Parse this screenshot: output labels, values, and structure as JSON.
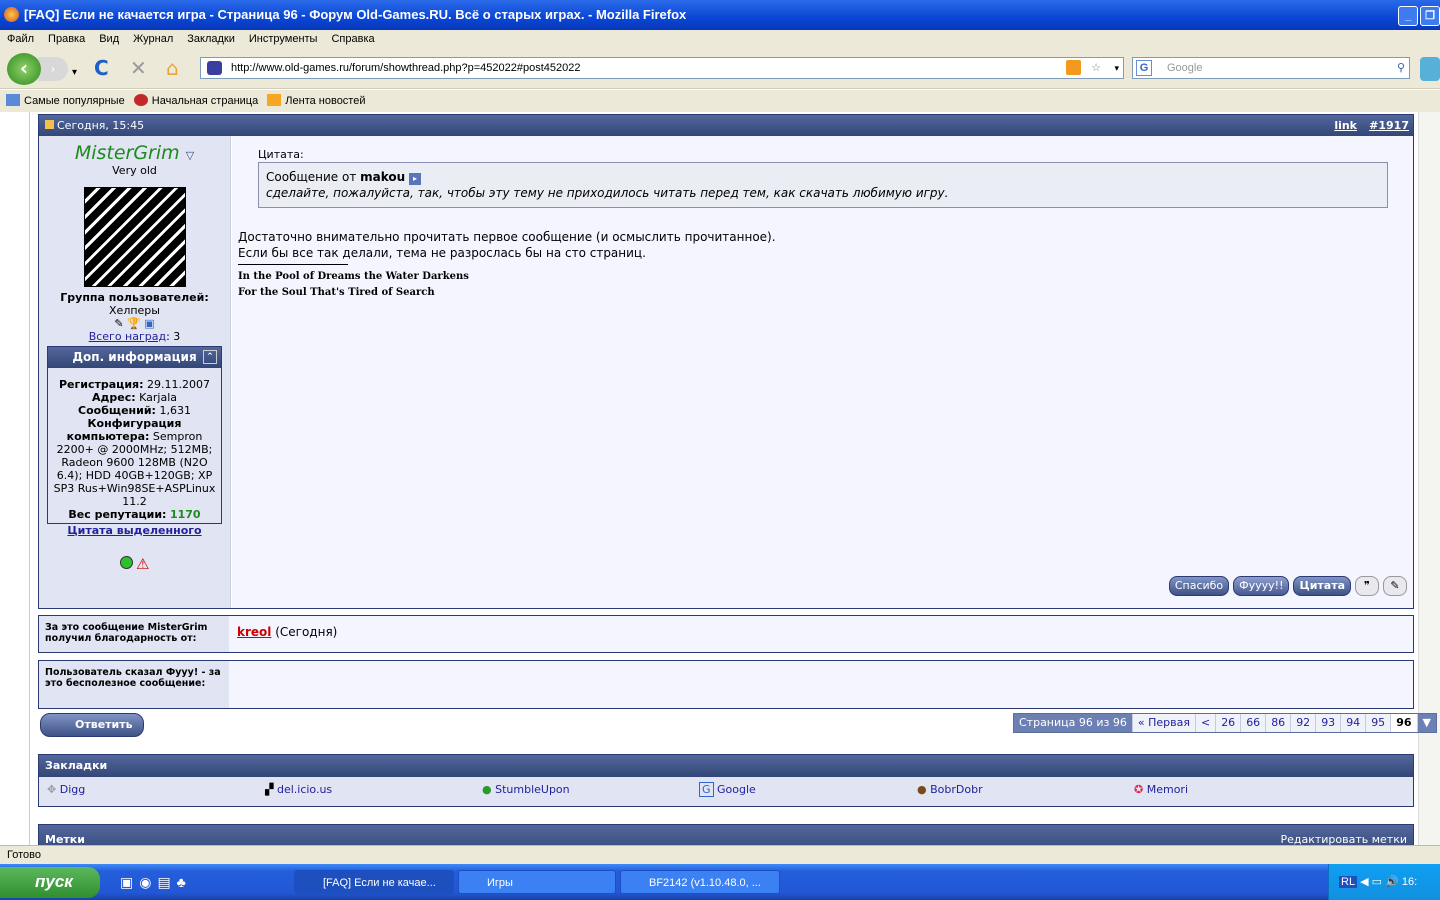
{
  "window": {
    "title": "[FAQ] Если не качается игра - Страница 96 - Форум Old-Games.RU. Всё о старых играх. - Mozilla Firefox"
  },
  "menu": [
    "Файл",
    "Правка",
    "Вид",
    "Журнал",
    "Закладки",
    "Инструменты",
    "Справка"
  ],
  "nav": {
    "url": "http://www.old-games.ru/forum/showthread.php?p=452022#post452022",
    "search_placeholder": "Google"
  },
  "bookmarks_bar": [
    "Самые популярные",
    "Начальная страница",
    "Лента новостей"
  ],
  "post": {
    "date": "Сегодня, 15:45",
    "link": "link",
    "number": "#1917",
    "username": "MisterGrim",
    "user_title": "Very old",
    "group_label": "Группа пользователей:",
    "group": "Хелперы",
    "awards_link": "Всего наград",
    "awards_count": ": 3",
    "info_title": "Доп. информация",
    "info": [
      {
        "k": "Регистрация:",
        "v": " 29.11.2007"
      },
      {
        "k": "Адрес:",
        "v": " Karjala"
      },
      {
        "k": "Сообщений:",
        "v": " 1,631"
      },
      {
        "k": "Конфигурация компьютера:",
        "v": " Sempron 2200+ @ 2000MHz; 512MB; Radeon 9600 128MB (N2O 6.4); HDD 40GB+120GB; XP SP3 Rus+Win98SE+ASPLinux 11.2"
      }
    ],
    "rep_label": "Вес репутации:",
    "rep": "1170",
    "quote_selected": "Цитата выделенного",
    "quote_label": "Цитата:",
    "quote_from": "Сообщение от ",
    "quote_author": "makou",
    "quote_text": "сделайте, пожалуйста, так, чтобы эту тему не приходилось читать перед тем, как скачать любимую игру.",
    "body": [
      "Достаточно внимательно прочитать первое сообщение (и осмыслить прочитанное).",
      "Если бы все так делали, тема не разрослась бы на сто страниц."
    ],
    "signature": [
      "In the Pool of Dreams the Water Darkens",
      "For the Soul That's Tired of Search"
    ],
    "buttons": {
      "thanks": "Спасибо",
      "fuuu": "Фуууу!!",
      "quote": "Цитата"
    }
  },
  "thanks": {
    "label": "За это сообщение MisterGrim получил благодарность от:",
    "user": "kreol",
    "when": " (Сегодня)"
  },
  "fuuu": {
    "label": "Пользователь сказал Фууу! - за это бесполезное сообщение:"
  },
  "reply_button": "Ответить",
  "pager": {
    "label": "Страница 96 из 96",
    "first": "« Первая",
    "prev": "<",
    "pages": [
      "26",
      "66",
      "86",
      "92",
      "93",
      "94",
      "95"
    ],
    "current": "96"
  },
  "social": {
    "title": "Закладки",
    "items": [
      "Digg",
      "del.icio.us",
      "StumbleUpon",
      "Google",
      "BobrDobr",
      "Memori"
    ]
  },
  "tags": {
    "title": "Метки",
    "edit": "Редактировать метки"
  },
  "status": "Готово",
  "taskbar": {
    "start": "пуск",
    "tasks": [
      "[FAQ] Если не качае...",
      "Игры",
      "BF2142 (v1.10.48.0, ..."
    ],
    "lang": "RL",
    "clock": "16:"
  }
}
